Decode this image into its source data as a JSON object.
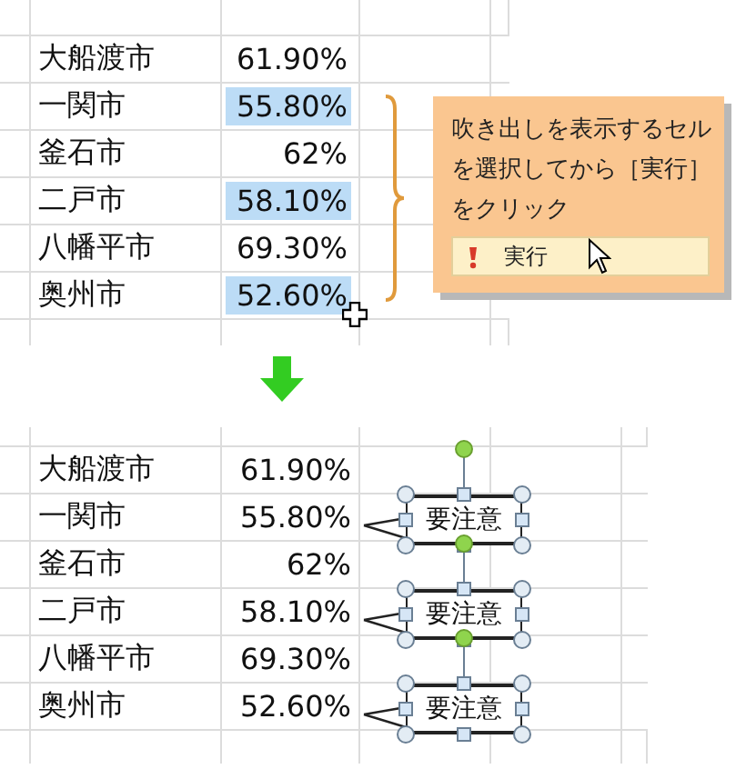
{
  "before": {
    "rows": [
      {
        "name": "大船渡市",
        "value": "61.90%",
        "selected": false
      },
      {
        "name": "一関市",
        "value": "55.80%",
        "selected": true
      },
      {
        "name": "釜石市",
        "value": "62%",
        "selected": false
      },
      {
        "name": "二戸市",
        "value": "58.10%",
        "selected": true
      },
      {
        "name": "八幡平市",
        "value": "69.30%",
        "selected": false
      },
      {
        "name": "奥州市",
        "value": "52.60%",
        "selected": true
      }
    ],
    "popup": {
      "text": "吹き出しを表示するセルを選択してから［実行］をクリック",
      "button": "実行"
    }
  },
  "after": {
    "rows": [
      {
        "name": "大船渡市",
        "value": "61.90%"
      },
      {
        "name": "一関市",
        "value": "55.80%",
        "callout": "要注意"
      },
      {
        "name": "釜石市",
        "value": "62%"
      },
      {
        "name": "二戸市",
        "value": "58.10%",
        "callout": "要注意"
      },
      {
        "name": "八幡平市",
        "value": "69.30%"
      },
      {
        "name": "奥州市",
        "value": "52.60%",
        "callout": "要注意"
      }
    ]
  }
}
